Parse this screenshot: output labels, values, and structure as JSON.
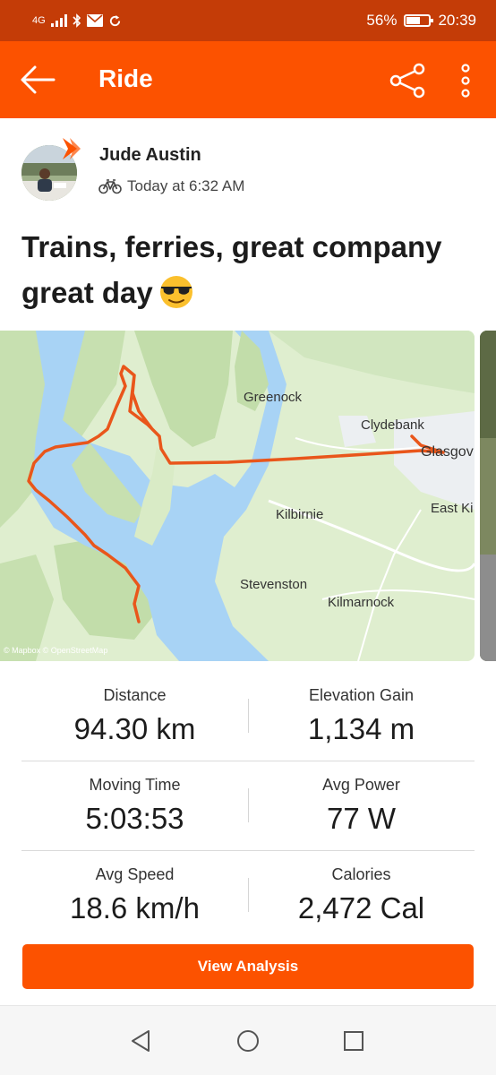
{
  "status_bar": {
    "network": "4G",
    "battery": "56%",
    "time": "20:39",
    "icons": [
      "signal-icon",
      "bluetooth-icon",
      "mail-icon",
      "sync-icon"
    ]
  },
  "app_bar": {
    "title": "Ride",
    "icons": [
      "back-arrow-icon",
      "share-icon",
      "more-icon"
    ]
  },
  "activity": {
    "athlete": "Jude Austin",
    "time": "Today at 6:32 AM",
    "title": "Trains, ferries, great company great day",
    "emoji": "sunglasses-emoji"
  },
  "map": {
    "labels": {
      "greenock": "Greenock",
      "clydebank": "Clydebank",
      "glasgow": "Glasgov",
      "kilbirnie": "Kilbirnie",
      "east_kilbride": "East Ki",
      "stevenston": "Stevenston",
      "kilmarnock": "Kilmarnock",
      "attribution": "© Mapbox © OpenStreetMap"
    }
  },
  "stats": [
    {
      "label": "Distance",
      "value": "94.30 km"
    },
    {
      "label": "Elevation Gain",
      "value": "1,134 m"
    },
    {
      "label": "Moving Time",
      "value": "5:03:53"
    },
    {
      "label": "Avg Power",
      "value": "77 W"
    },
    {
      "label": "Avg Speed",
      "value": "18.6 km/h"
    },
    {
      "label": "Calories",
      "value": "2,472 Cal"
    }
  ],
  "actions": {
    "view_analysis": "View Analysis"
  },
  "colors": {
    "brand": "#fc5200",
    "status_bar": "#c43c07",
    "route": "#e9561b",
    "water": "#a8d3f5",
    "land": "#dfeecf"
  }
}
